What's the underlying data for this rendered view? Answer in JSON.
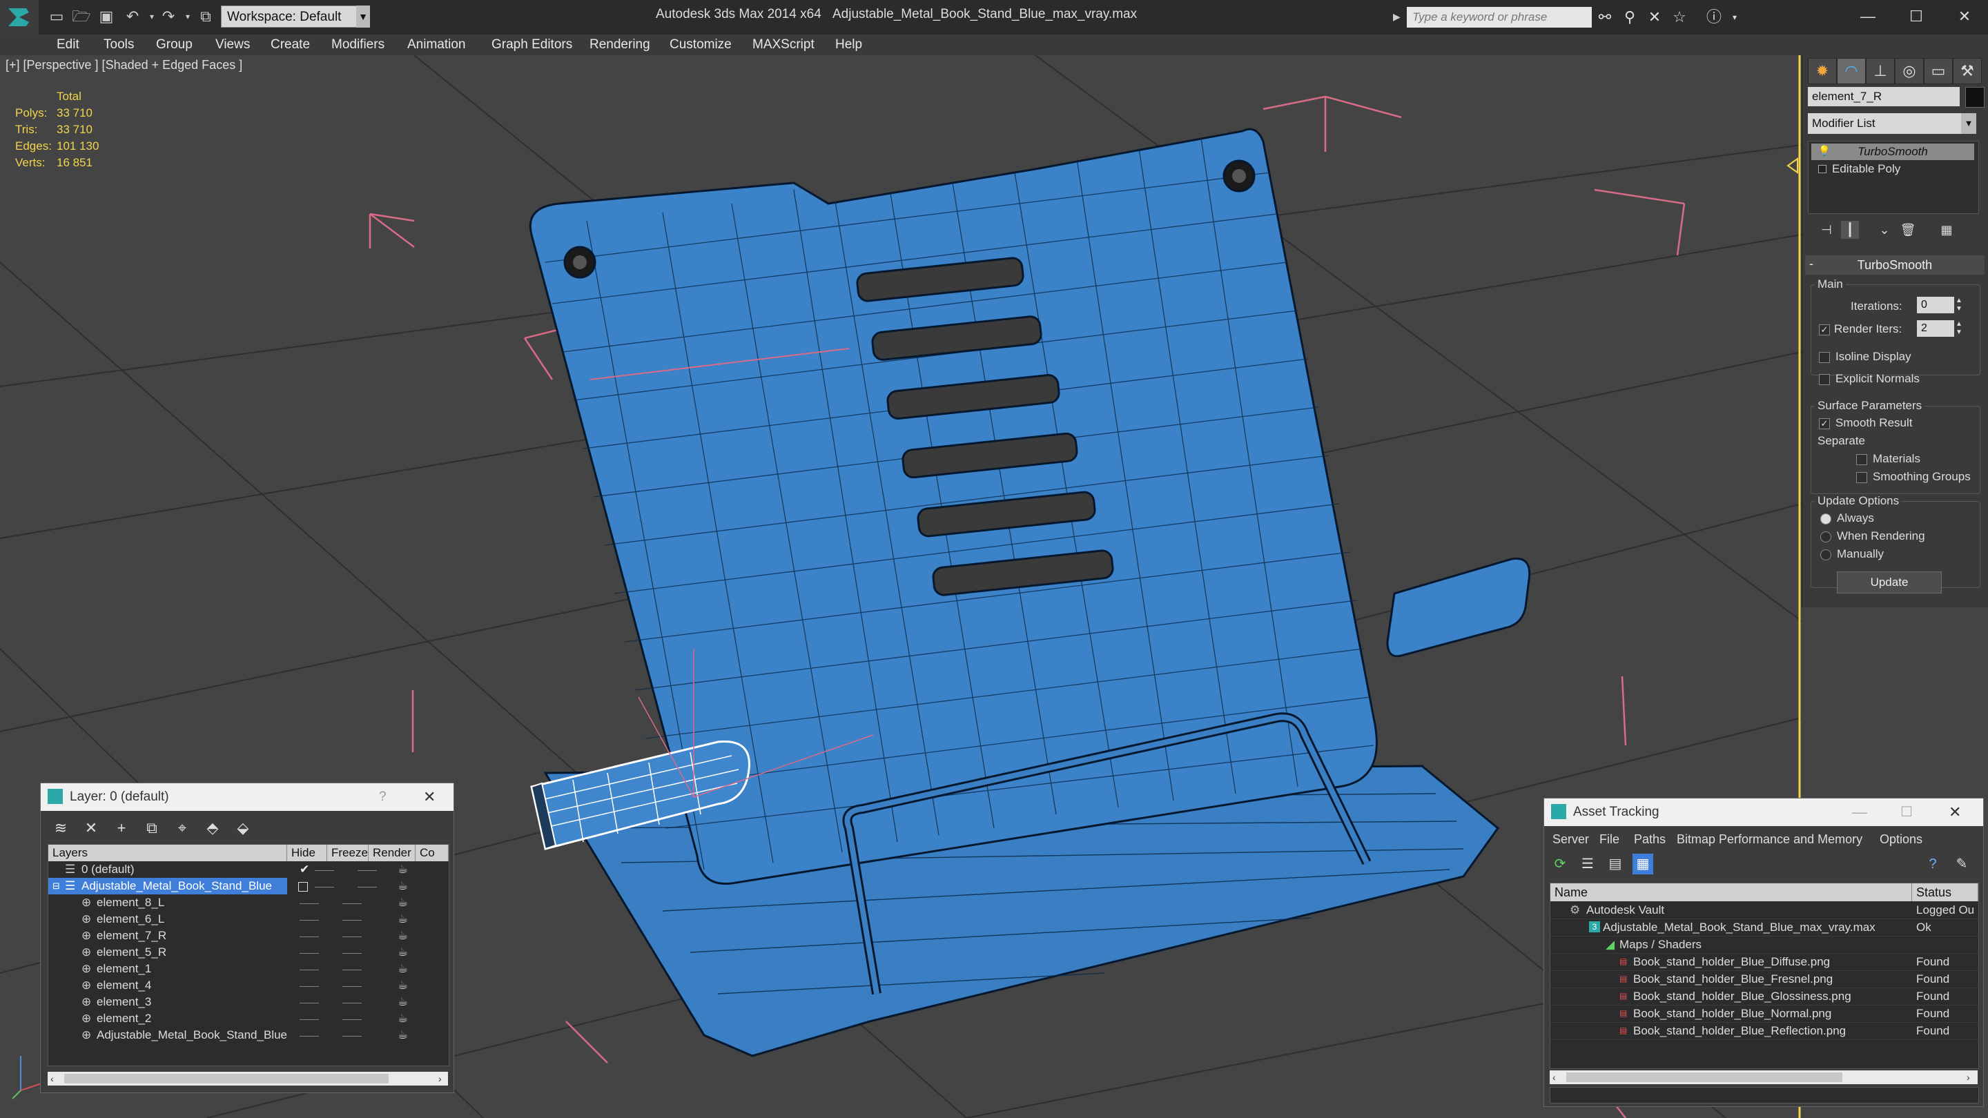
{
  "titlebar": {
    "workspace": "Workspace: Default",
    "app_title": "Autodesk 3ds Max  2014 x64",
    "file_title": "Adjustable_Metal_Book_Stand_Blue_max_vray.max",
    "search_placeholder": "Type a keyword or phrase"
  },
  "menu": [
    "Edit",
    "Tools",
    "Group",
    "Views",
    "Create",
    "Modifiers",
    "Animation",
    "Graph Editors",
    "Rendering",
    "Customize",
    "MAXScript",
    "Help"
  ],
  "viewport": {
    "label": "[+] [Perspective ] [Shaded + Edged Faces ]",
    "stats": {
      "header": "Total",
      "rows": [
        {
          "label": "Polys:",
          "value": "33 710"
        },
        {
          "label": "Tris:",
          "value": "33 710"
        },
        {
          "label": "Edges:",
          "value": "101 130"
        },
        {
          "label": "Verts:",
          "value": "16 851"
        }
      ]
    }
  },
  "command_panel": {
    "object_name": "element_7_R",
    "modifier_list": "Modifier List",
    "stack": [
      "TurboSmooth",
      "Editable Poly"
    ],
    "turbosmooth": {
      "title": "TurboSmooth",
      "main": "Main",
      "iterations_label": "Iterations:",
      "iterations_value": "0",
      "render_iters_label": "Render Iters:",
      "render_iters_value": "2",
      "isoline": "Isoline Display",
      "explicit_normals": "Explicit Normals",
      "surface_params": "Surface Parameters",
      "smooth_result": "Smooth Result",
      "separate": "Separate",
      "materials": "Materials",
      "smoothing_groups": "Smoothing Groups",
      "update_options": "Update Options",
      "always": "Always",
      "when_rendering": "When Rendering",
      "manually": "Manually",
      "update_button": "Update"
    }
  },
  "layer_window": {
    "title": "Layer: 0 (default)",
    "help": "?",
    "columns": [
      "Layers",
      "Hide",
      "Freeze",
      "Render",
      "Co"
    ],
    "rows": [
      {
        "name": "0 (default)",
        "indent": 1
      },
      {
        "name": "Adjustable_Metal_Book_Stand_Blue",
        "indent": 1
      },
      {
        "name": "element_8_L",
        "indent": 2
      },
      {
        "name": "element_6_L",
        "indent": 2
      },
      {
        "name": "element_7_R",
        "indent": 2
      },
      {
        "name": "element_5_R",
        "indent": 2
      },
      {
        "name": "element_1",
        "indent": 2
      },
      {
        "name": "element_4",
        "indent": 2
      },
      {
        "name": "element_3",
        "indent": 2
      },
      {
        "name": "element_2",
        "indent": 2
      },
      {
        "name": "Adjustable_Metal_Book_Stand_Blue",
        "indent": 2
      }
    ]
  },
  "asset_tracking": {
    "title": "Asset Tracking",
    "menu": [
      "Server",
      "File",
      "Paths",
      "Bitmap Performance and Memory",
      "Options"
    ],
    "columns": [
      "Name",
      "Status"
    ],
    "rows": [
      {
        "name": "Autodesk Vault",
        "status": "Logged Ou",
        "indent": 1
      },
      {
        "name": "Adjustable_Metal_Book_Stand_Blue_max_vray.max",
        "status": "Ok",
        "indent": 2
      },
      {
        "name": "Maps / Shaders",
        "status": "",
        "indent": 3
      },
      {
        "name": "Book_stand_holder_Blue_Diffuse.png",
        "status": "Found",
        "indent": 4
      },
      {
        "name": "Book_stand_holder_Blue_Fresnel.png",
        "status": "Found",
        "indent": 4
      },
      {
        "name": "Book_stand_holder_Blue_Glossiness.png",
        "status": "Found",
        "indent": 4
      },
      {
        "name": "Book_stand_holder_Blue_Normal.png",
        "status": "Found",
        "indent": 4
      },
      {
        "name": "Book_stand_holder_Blue_Reflection.png",
        "status": "Found",
        "indent": 4
      }
    ]
  },
  "colors": {
    "model_blue": "#3b80c4",
    "stat_yellow": "#f3d44c",
    "selection_blue": "#3f7fd9",
    "bbox_pink": "#d86b86"
  }
}
